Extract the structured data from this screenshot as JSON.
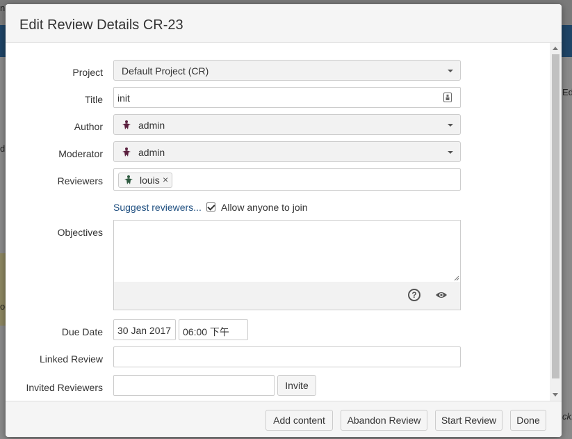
{
  "background": {
    "left_text_1": "n",
    "left_text_2": "d",
    "left_text_3": "oc",
    "right_text_1": "Ed",
    "right_text_2": "ck."
  },
  "dialog": {
    "title": "Edit Review Details CR-23",
    "fields": {
      "project": {
        "label": "Project",
        "value": "Default Project (CR)"
      },
      "title": {
        "label": "Title",
        "value": "init"
      },
      "author": {
        "label": "Author",
        "value": "admin"
      },
      "moderator": {
        "label": "Moderator",
        "value": "admin"
      },
      "reviewers": {
        "label": "Reviewers",
        "chips": [
          "louis"
        ],
        "remove_glyph": "×"
      },
      "suggest_link": "Suggest reviewers...",
      "allow_join": {
        "label": "Allow anyone to join",
        "checked": true
      },
      "objectives": {
        "label": "Objectives",
        "value": ""
      },
      "due_date": {
        "label": "Due Date",
        "date": "30 Jan 2017",
        "time": "06:00 下午"
      },
      "linked_review": {
        "label": "Linked Review",
        "value": ""
      },
      "invited_reviewers": {
        "label": "Invited Reviewers",
        "value": "",
        "invite_button": "Invite"
      }
    },
    "footer": {
      "add_content": "Add content",
      "abandon": "Abandon Review",
      "start": "Start Review",
      "done": "Done"
    }
  },
  "colors": {
    "user_icon_author": "#5a1f3d",
    "user_icon_reviewer": "#2e5a40",
    "link": "#205081"
  }
}
